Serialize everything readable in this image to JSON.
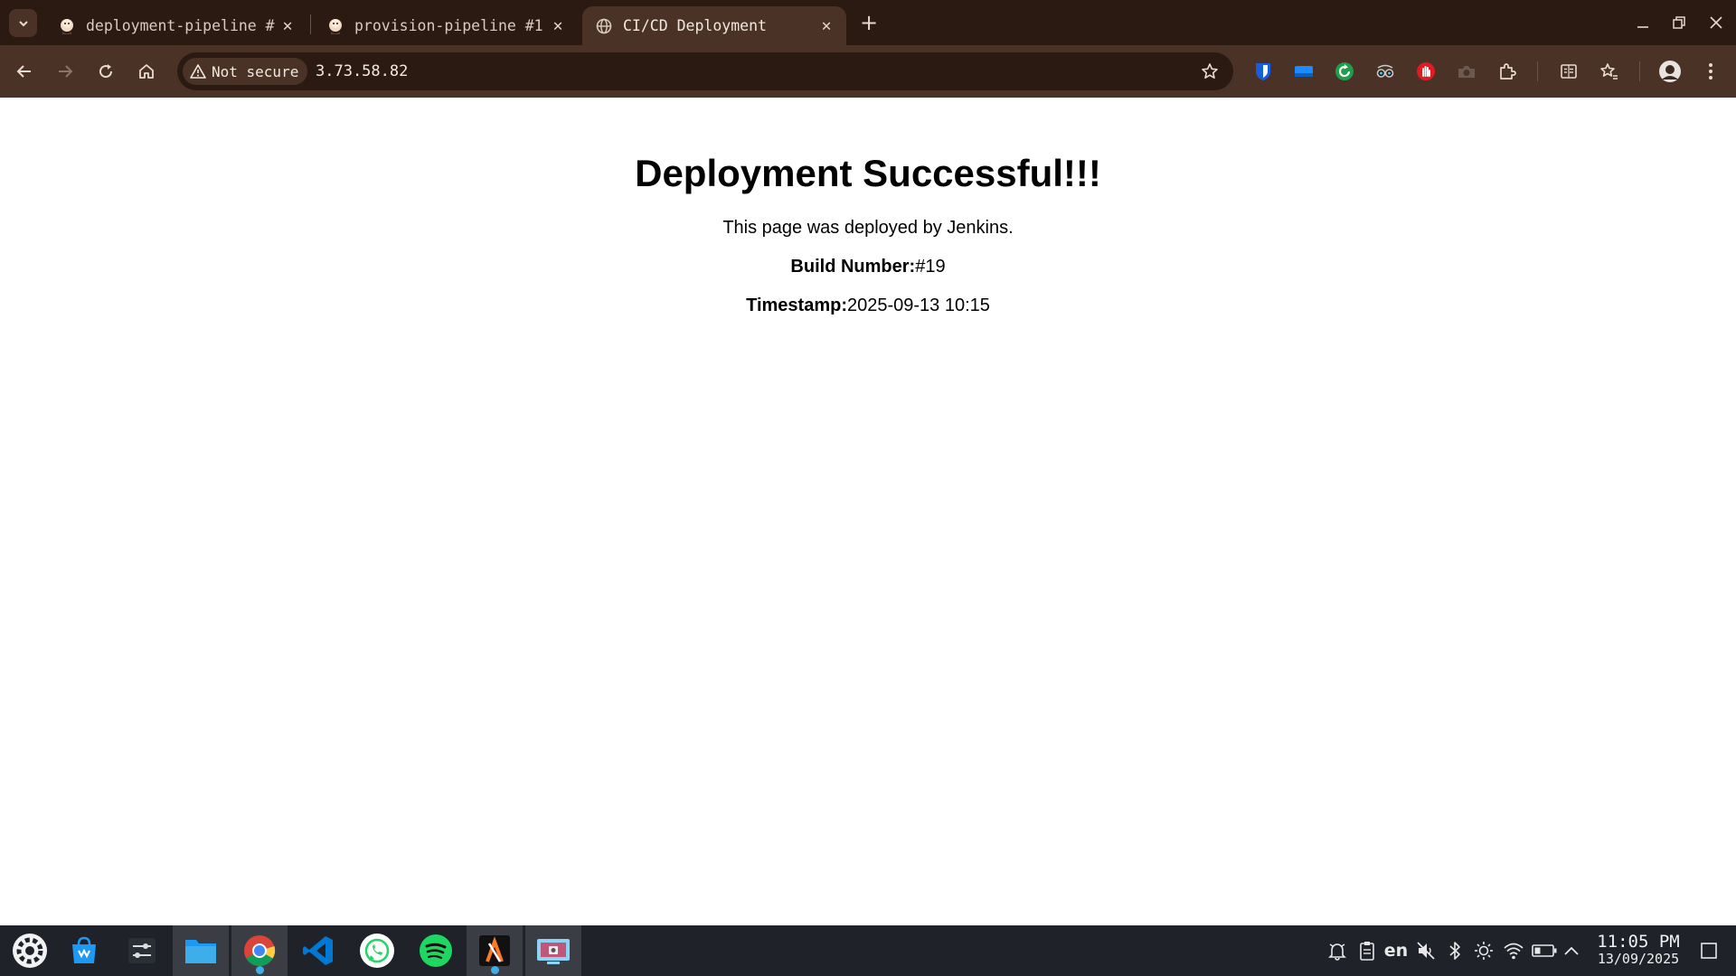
{
  "browser": {
    "tabs": [
      {
        "title": "deployment-pipeline #",
        "icon": "jenkins-icon",
        "active": false
      },
      {
        "title": "provision-pipeline #1",
        "icon": "jenkins-icon",
        "active": false
      },
      {
        "title": "CI/CD Deployment",
        "icon": "globe-icon",
        "active": true
      }
    ],
    "security_chip": "Not secure",
    "url": "3.73.58.82"
  },
  "page": {
    "heading": "Deployment Successful!!!",
    "description": "This page was deployed by Jenkins.",
    "build_label": "Build Number:",
    "build_value": "#19",
    "timestamp_label": "Timestamp:",
    "timestamp_value": "2025-09-13 10:15"
  },
  "taskbar": {
    "apps": [
      "app-launcher-icon",
      "discover-store-icon",
      "system-settings-icon",
      "file-manager-icon",
      "chrome-icon",
      "vscode-icon",
      "whatsapp-icon",
      "spotify-icon",
      "xampp-icon",
      "screenshot-tool-icon"
    ],
    "language": "en",
    "time": "11:05 PM",
    "date": "13/09/2025"
  },
  "colors": {
    "tabstrip_bg": "#2b1a12",
    "toolbar_bg": "#4a3226",
    "taskbar_bg": "#1f2228"
  }
}
